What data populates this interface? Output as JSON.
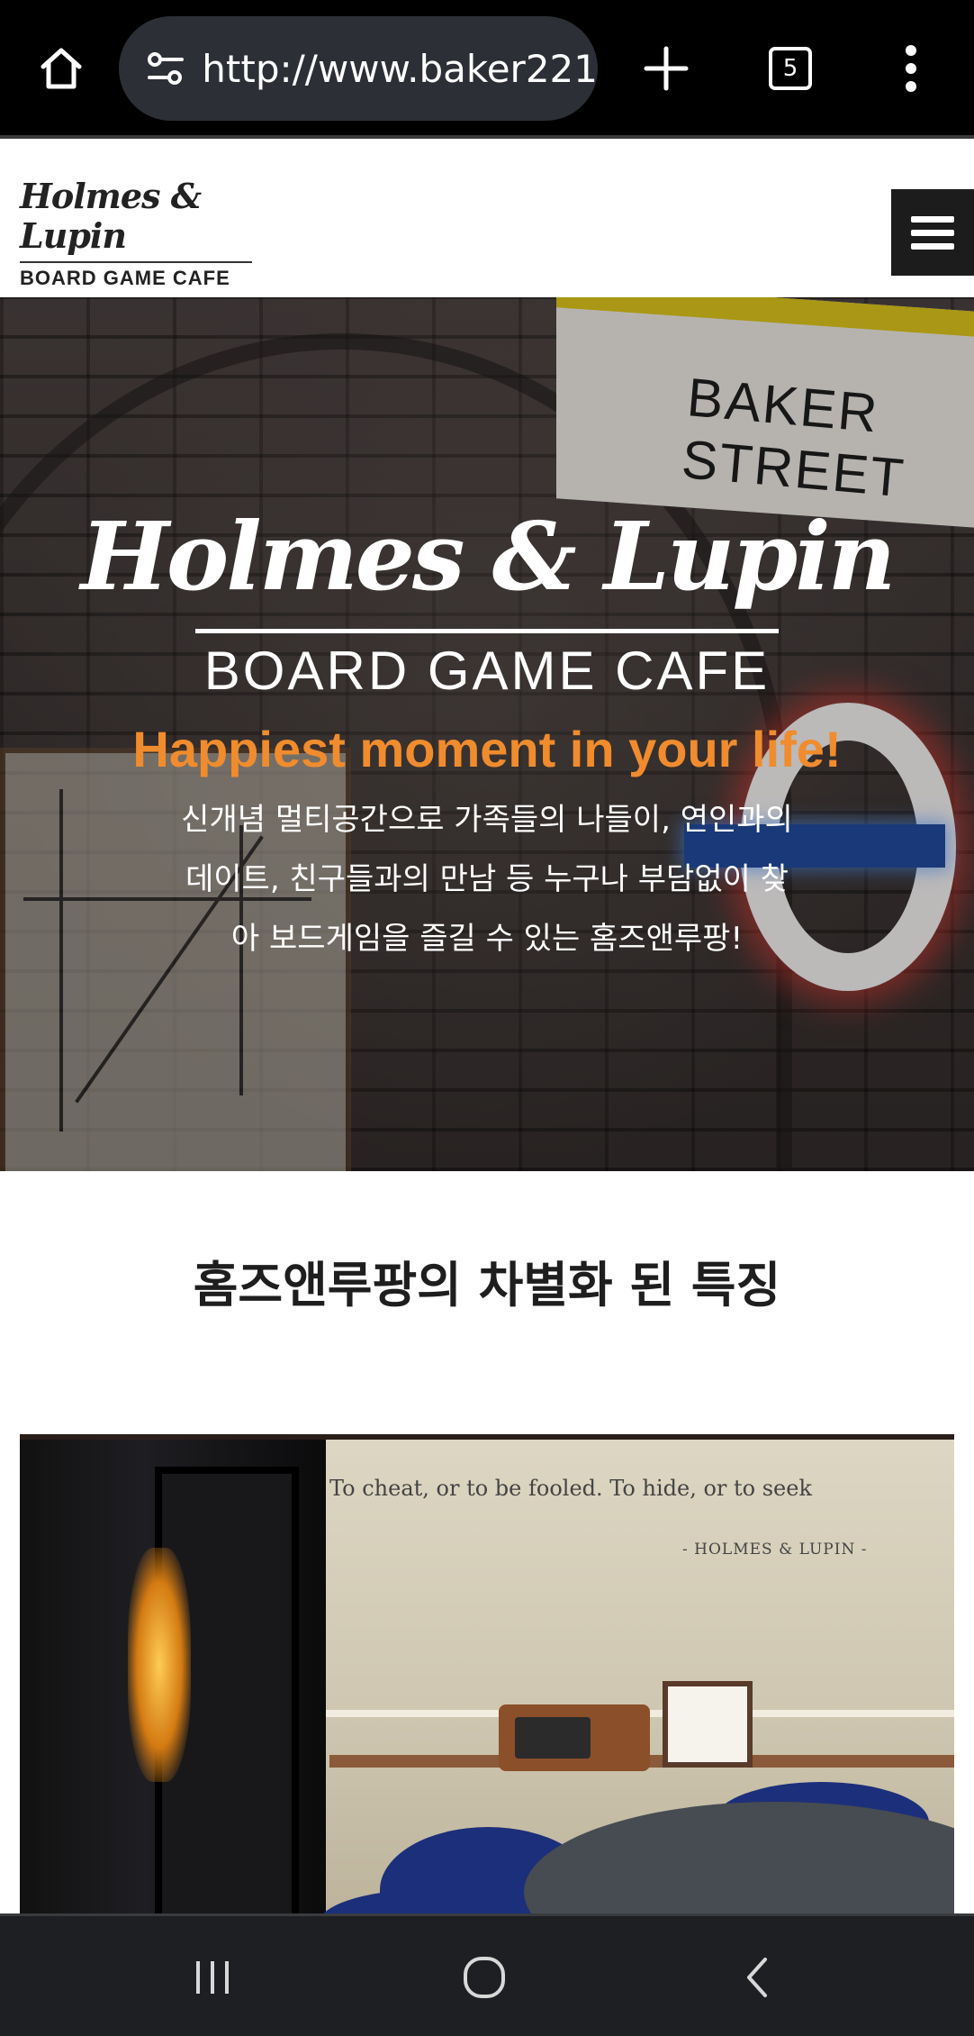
{
  "browser": {
    "url": "http://www.baker221",
    "tab_count": "5",
    "icons": [
      "home-icon",
      "site-settings-icon",
      "new-tab-icon",
      "tabs-icon",
      "overflow-menu-icon"
    ]
  },
  "site": {
    "logo_script": "Holmes & Lupin",
    "logo_sub": "BOARD GAME CAFE"
  },
  "hero": {
    "script_title": "Holmes & Lupin",
    "subtitle": "BOARD GAME CAFE",
    "headline": "Happiest moment in your life!",
    "description": "신개념 멀티공간으로 가족들의 나들이, 연인과의 데이트, 친구들과의 만남 등 누구나 부담없이 찾아 보드게임을 즐길 수 있는 홈즈앤루팡!",
    "sign_text": "BAKER STREET",
    "colors": {
      "headline": "#f08c2e"
    }
  },
  "section": {
    "title": "홈즈앤루팡의 차별화 된 특징"
  },
  "feature_image": {
    "quote_line1": "To cheat, or to be fooled. To hide, or to seek",
    "quote_line2": "- HOLMES & LUPIN -"
  },
  "system_nav": {
    "icons": [
      "recent-apps-icon",
      "home-circle-icon",
      "back-icon"
    ]
  }
}
